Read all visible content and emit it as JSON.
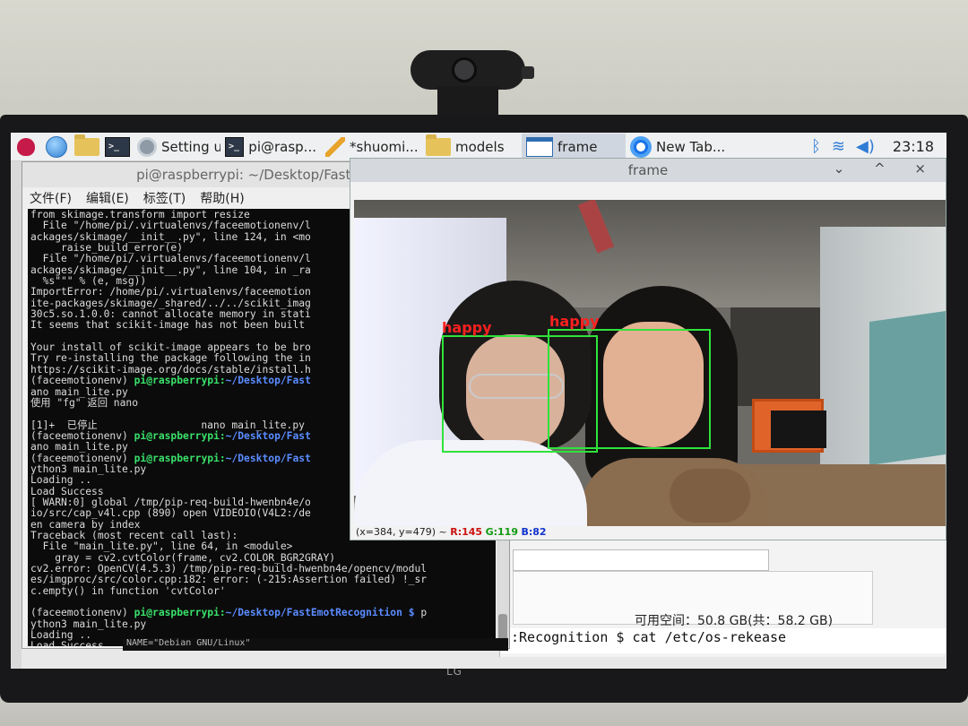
{
  "taskbar": {
    "tasks": [
      {
        "label": "Setting u..."
      },
      {
        "label": "pi@rasp..."
      },
      {
        "label": "*shuomi..."
      },
      {
        "label": "models"
      },
      {
        "label": "frame"
      },
      {
        "label": "New Tab..."
      }
    ],
    "clock": "23:18"
  },
  "terminal": {
    "title": "pi@raspberrypi: ~/Desktop/FastEmotR",
    "menu": [
      "文件(F)",
      "编辑(E)",
      "标签(T)",
      "帮助(H)"
    ],
    "lines": [
      [
        "from skimage.transform import resize"
      ],
      [
        "  File \"/home/pi/.virtualenvs/faceemotionenv/l"
      ],
      [
        "ackages/skimage/__init__.py\", line 124, in <mo"
      ],
      [
        "    _raise_build_error(e)"
      ],
      [
        "  File \"/home/pi/.virtualenvs/faceemotionenv/l"
      ],
      [
        "ackages/skimage/__init__.py\", line 104, in _ra"
      ],
      [
        "  %s\"\"\" % (e, msg))"
      ],
      [
        "ImportError: /home/pi/.virtualenvs/faceemotion"
      ],
      [
        "ite-packages/skimage/_shared/../../scikit_imag"
      ],
      [
        "30c5.so.1.0.0: cannot allocate memory in stati"
      ],
      [
        "It seems that scikit-image has not been built"
      ],
      [
        ""
      ],
      [
        "Your install of scikit-image appears to be bro"
      ],
      [
        "Try re-installing the package following the in"
      ],
      [
        "https://scikit-image.org/docs/stable/install.h"
      ],
      [
        "(faceemotionenv) ",
        "pi@raspberrypi",
        ":",
        "~/Desktop/Fast"
      ],
      [
        "ano main_lite.py"
      ],
      [
        "使用 \"fg\" 返回 nano"
      ],
      [
        ""
      ],
      [
        "[1]+  已停止                 nano main_lite.py"
      ],
      [
        "(faceemotionenv) ",
        "pi@raspberrypi",
        ":",
        "~/Desktop/Fast"
      ],
      [
        "ano main_lite.py"
      ],
      [
        "(faceemotionenv) ",
        "pi@raspberrypi",
        ":",
        "~/Desktop/Fast"
      ],
      [
        "ython3 main_lite.py"
      ],
      [
        "Loading .."
      ],
      [
        "Load Success"
      ],
      [
        "[ WARN:0] global /tmp/pip-req-build-hwenbn4e/o"
      ],
      [
        "io/src/cap_v4l.cpp (890) open VIDEOIO(V4L2:/de"
      ],
      [
        "en camera by index"
      ],
      [
        "Traceback (most recent call last):"
      ],
      [
        "  File \"main_lite.py\", line 64, in <module>"
      ],
      [
        "    gray = cv2.cvtColor(frame, cv2.COLOR_BGR2GRAY)"
      ],
      [
        "cv2.error: OpenCV(4.5.3) /tmp/pip-req-build-hwenbn4e/opencv/modul"
      ],
      [
        "es/imgproc/src/color.cpp:182: error: (-215:Assertion failed) !_sr"
      ],
      [
        "c.empty() in function 'cvtColor'"
      ],
      [
        ""
      ],
      [
        "(faceemotionenv) ",
        "pi@raspberrypi",
        ":",
        "~/Desktop/FastEmotRecognition $ ",
        "p"
      ],
      [
        "ython3 main_lite.py"
      ],
      [
        "Loading .."
      ],
      [
        "Load Success"
      ]
    ],
    "bottom_strip": "NAME=\"Debian GNU/Linux\""
  },
  "frame_window": {
    "title": "frame",
    "controls": "⌄ ^ ×",
    "detections": [
      {
        "label": "happy"
      },
      {
        "label": "happy"
      }
    ],
    "status": {
      "coords": "(x=384, y=479) ~ ",
      "r": "R:145",
      "g": "G:119",
      "b": "B:82"
    }
  },
  "background_app": {
    "free_space": "可用空间：50.8 GB(共：58.2 GB)",
    "terminal_line": ":Recognition $ cat /etc/os-rekease"
  },
  "monitor": {
    "brand": "LG"
  },
  "colors": {
    "box": "#2fe33a",
    "emotion_text": "#ff2020",
    "prompt_user": "#39e06a",
    "prompt_path": "#5a8cff"
  }
}
